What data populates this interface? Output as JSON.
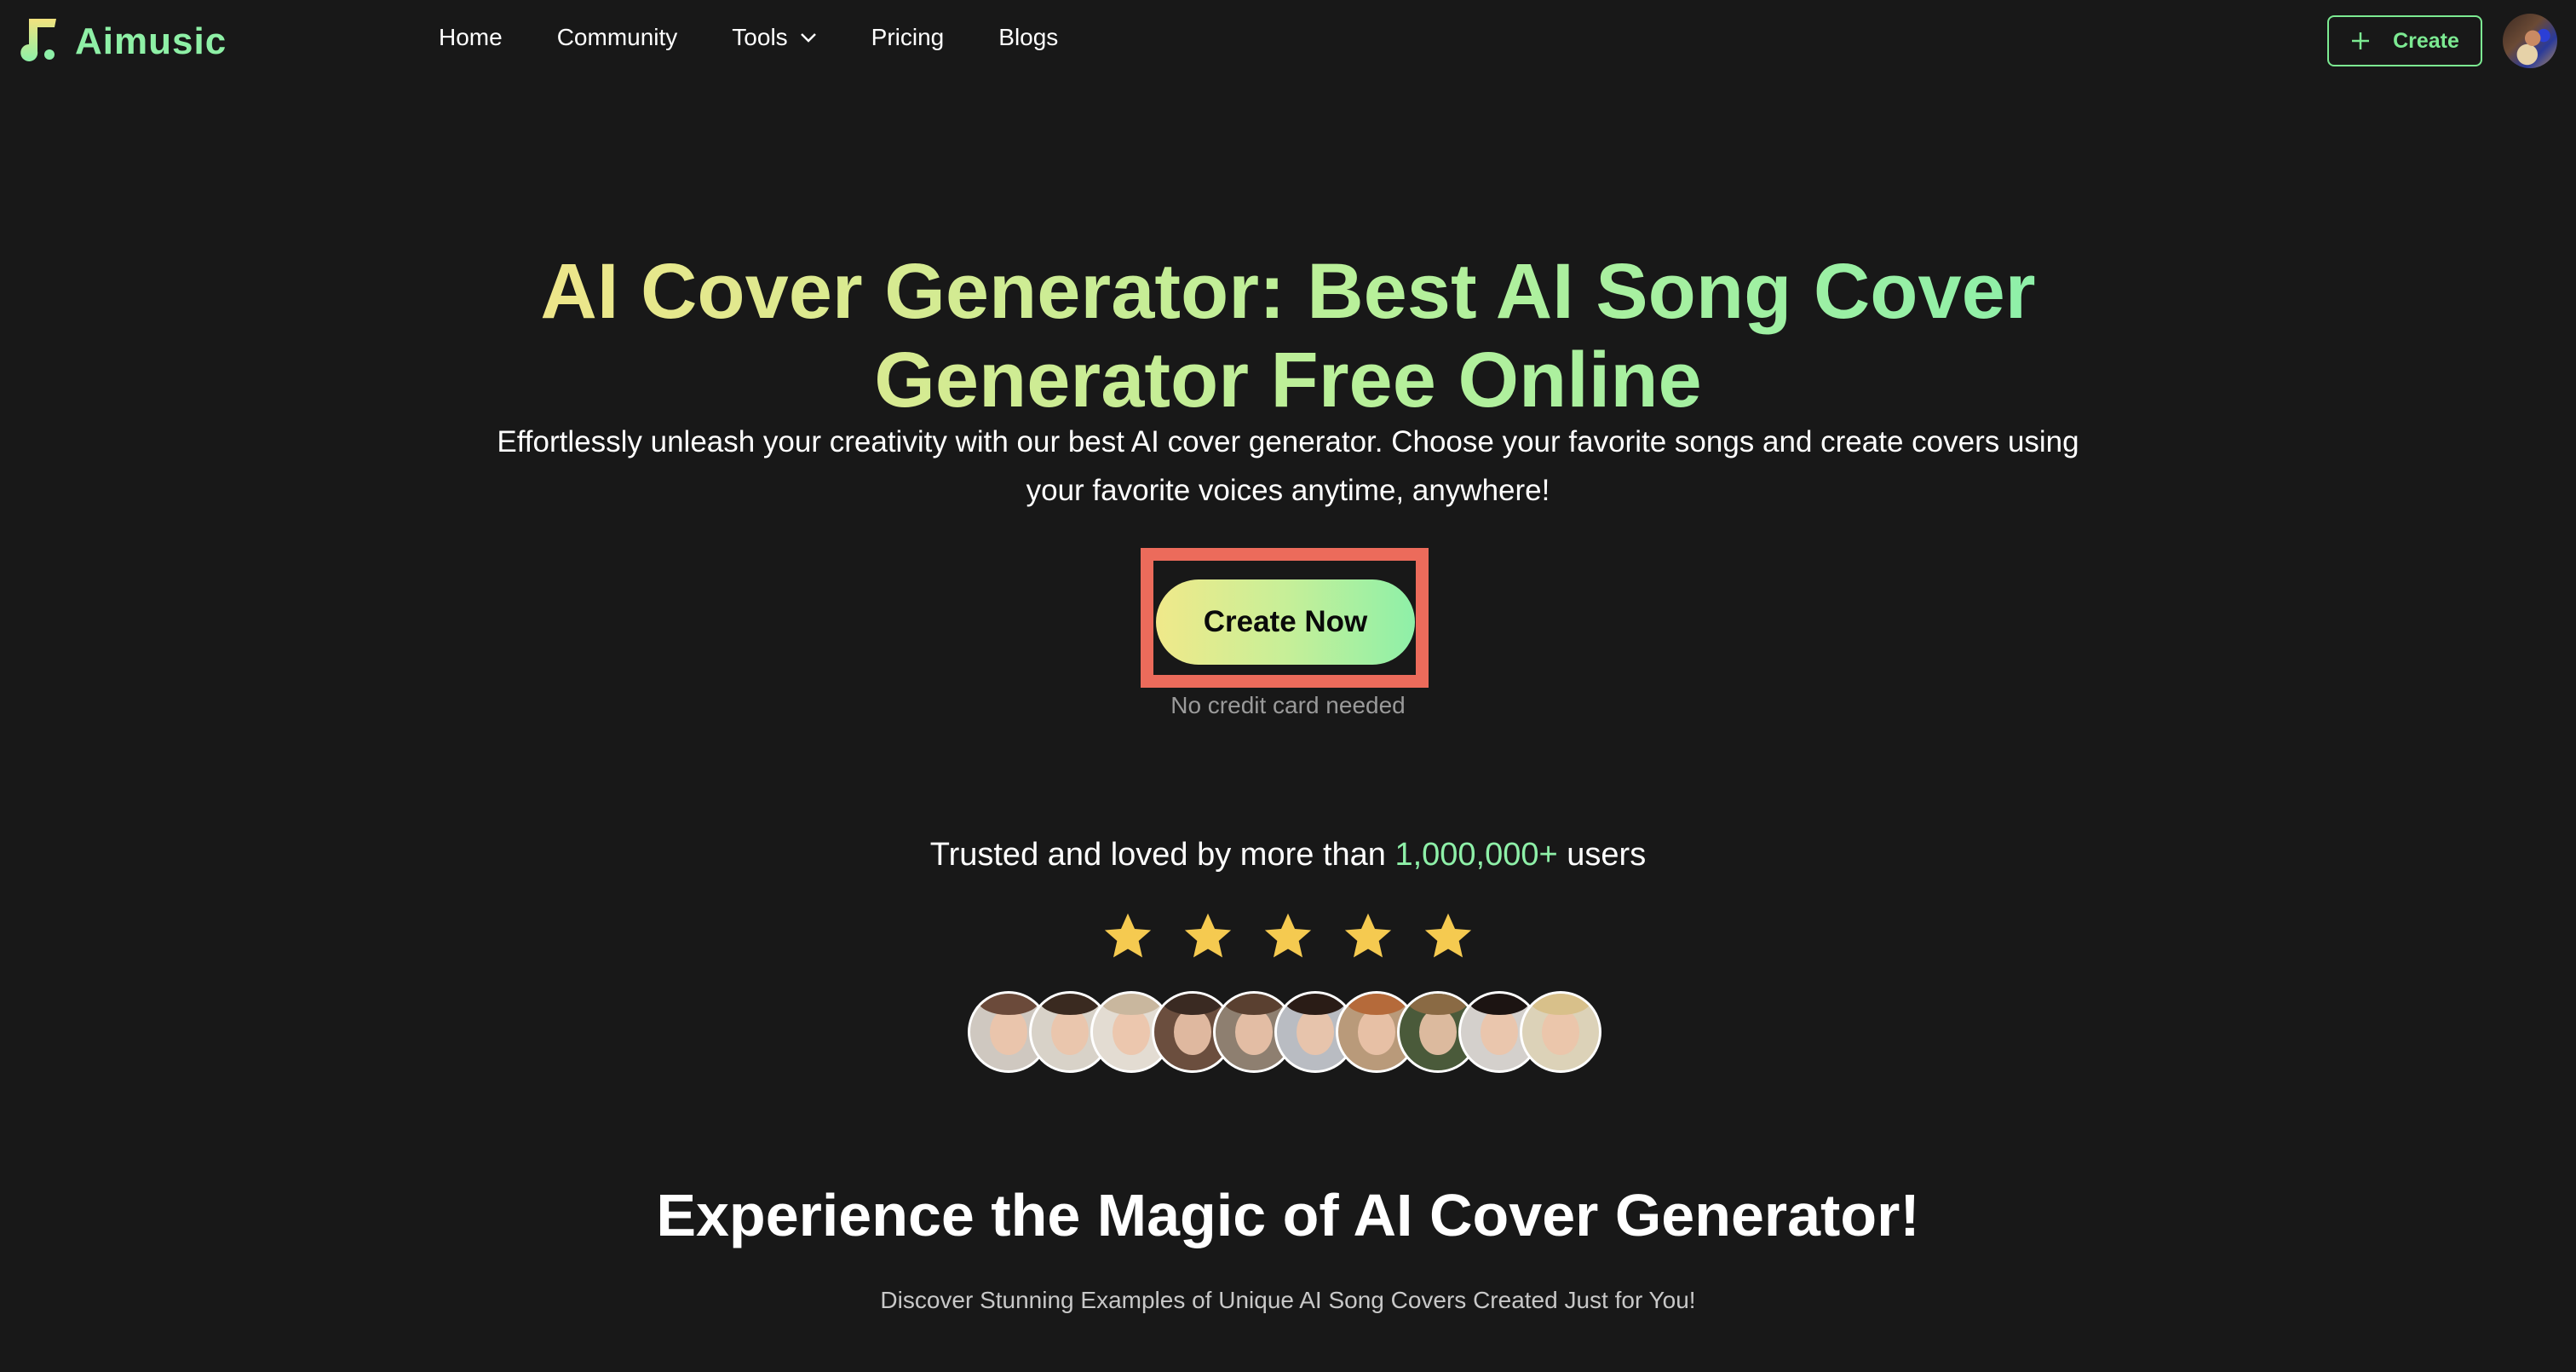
{
  "header": {
    "logo_text": "Aimusic",
    "nav": [
      {
        "label": "Home",
        "has_dropdown": false
      },
      {
        "label": "Community",
        "has_dropdown": false
      },
      {
        "label": "Tools",
        "has_dropdown": true
      },
      {
        "label": "Pricing",
        "has_dropdown": false
      },
      {
        "label": "Blogs",
        "has_dropdown": false
      }
    ],
    "create_button": {
      "label": "Create",
      "icon": "plus-icon"
    },
    "avatar": {
      "icon": "user-avatar"
    }
  },
  "hero": {
    "title": "AI Cover Generator: Best AI Song Cover Generator Free Online",
    "subtitle": "Effortlessly unleash your creativity with our best AI cover generator. Choose your favorite songs and create covers using your favorite voices anytime, anywhere!",
    "cta_label": "Create Now",
    "cta_note": "No credit card needed"
  },
  "trust": {
    "prefix": "Trusted and loved by more than",
    "count": "1,000,000+",
    "suffix": "users",
    "rating": 5,
    "rating_max": 5,
    "user_avatars": 10
  },
  "section": {
    "title": "Experience the Magic of AI Cover Generator!",
    "subtitle": "Discover Stunning Examples of Unique AI Song Covers Created Just for You!"
  },
  "colors": {
    "background": "#181818",
    "accent_green": "#8ef0a8",
    "accent_yellow": "#eee68a",
    "highlight_red": "#ec6b5b",
    "star_yellow": "#f5ca50",
    "button_border_green": "#7cea92"
  }
}
